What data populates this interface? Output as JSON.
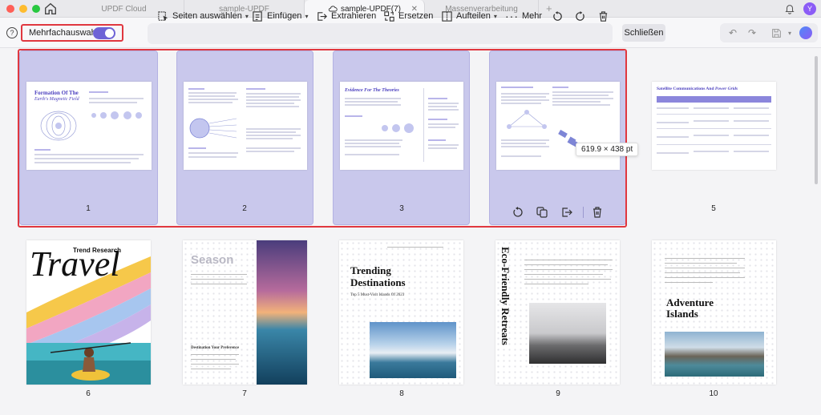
{
  "titlebar": {
    "tabs": [
      {
        "label": "UPDF Cloud"
      },
      {
        "label": "sample-UPDF"
      },
      {
        "label": "sample-UPDF(7)"
      },
      {
        "label": "Massenverarbeitung"
      }
    ],
    "avatar_initial": "Y"
  },
  "toolbar": {
    "multi_select_label": "Mehrfachauswahl",
    "multi_select_on": true,
    "help_glyph": "?",
    "select_pages": "Seiten auswählen",
    "insert": "Einfügen",
    "extract": "Extrahieren",
    "replace": "Ersetzen",
    "split": "Aufteilen",
    "more": "Mehr",
    "close": "Schließen"
  },
  "dim_tooltip": "619.9 × 438 pt",
  "pages": [
    {
      "num": "1",
      "title_a": "Formation Of The",
      "title_b": "Earth's Magnetic Field",
      "selected": true
    },
    {
      "num": "2",
      "selected": true
    },
    {
      "num": "3",
      "title_a": "Evidence For The Theories",
      "selected": true
    },
    {
      "num": "4",
      "selected": true
    },
    {
      "num": "5",
      "title_a": "Satellite Communications And",
      "title_b": "Power Grids",
      "selected": false
    },
    {
      "num": "6",
      "title_a": "Travel",
      "title_b": "Trend Research",
      "selected": false
    },
    {
      "num": "7",
      "title_a": "Season",
      "title_b": "Destination Your Preference",
      "selected": false
    },
    {
      "num": "8",
      "title_a": "Trending",
      "title_b": "Destinations",
      "subtitle": "Top 5 Must-Visit Islands Of 2023",
      "selected": false
    },
    {
      "num": "9",
      "title_a": "Eco-Friendly Retreats",
      "selected": false
    },
    {
      "num": "10",
      "title_a": "Adventure",
      "title_b": "Islands",
      "selected": false
    }
  ],
  "colors": {
    "selection_fill": "#c9c8ec",
    "selection_border": "#e0373f",
    "toggle": "#6e63d6"
  }
}
